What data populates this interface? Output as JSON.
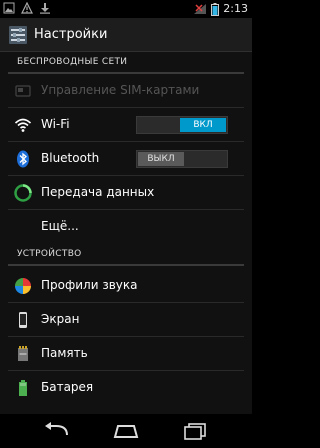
{
  "status_bar": {
    "time": "2:13",
    "left_icons": [
      "image-icon",
      "warning-icon",
      "download-icon"
    ],
    "right_icons": [
      "no-signal-icon",
      "battery-icon"
    ]
  },
  "action_bar": {
    "icon": "settings-icon",
    "title": "Настройки"
  },
  "sections": {
    "wireless": "БЕСПРОВОДНЫЕ СЕТИ",
    "device": "УСТРОЙСТВО"
  },
  "items": {
    "sim": {
      "label": "Управление SIM-картами",
      "icon": "sim-card-icon",
      "enabled": false
    },
    "wifi": {
      "label": "Wi-Fi",
      "icon": "wifi-icon",
      "toggle_label": "ВКЛ",
      "toggle_state": "on"
    },
    "bluetooth": {
      "label": "Bluetooth",
      "icon": "bluetooth-icon",
      "toggle_label": "ВЫКЛ",
      "toggle_state": "off"
    },
    "data": {
      "label": "Передача данных",
      "icon": "data-usage-icon"
    },
    "more": {
      "label": "Ещё..."
    },
    "sound": {
      "label": "Профили звука",
      "icon": "sound-profiles-icon"
    },
    "display": {
      "label": "Экран",
      "icon": "display-icon"
    },
    "storage": {
      "label": "Память",
      "icon": "storage-icon"
    },
    "battery": {
      "label": "Батарея",
      "icon": "battery-icon"
    }
  },
  "colors": {
    "accent": "#0099cc",
    "background": "#111111",
    "action_bar": "#1d1d1d"
  }
}
